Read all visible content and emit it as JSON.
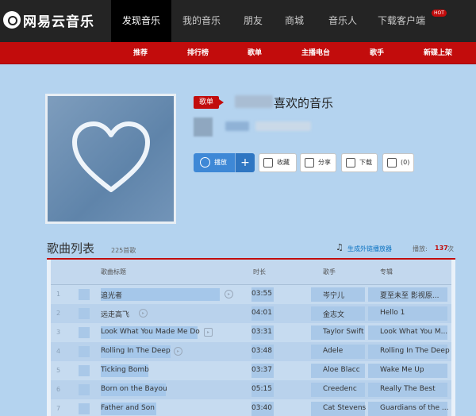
{
  "brand": {
    "logo_text": "网易云音乐"
  },
  "top_nav": [
    {
      "label": "发现音乐",
      "active": true
    },
    {
      "label": "我的音乐",
      "active": false
    },
    {
      "label": "朋友",
      "active": false
    },
    {
      "label": "商城",
      "active": false
    },
    {
      "label": "音乐人",
      "active": false
    },
    {
      "label": "下载客户端",
      "active": false
    }
  ],
  "hot_badge": "HOT",
  "sub_nav": [
    "推荐",
    "排行榜",
    "歌单",
    "主播电台",
    "歌手",
    "新碟上架"
  ],
  "playlist": {
    "tag": "歌单",
    "title": "喜欢的音乐",
    "buttons": {
      "play": "播放",
      "add": "+",
      "collect": "收藏",
      "share": "分享",
      "download": "下载",
      "comment": "(0)"
    }
  },
  "song_list": {
    "title": "歌曲列表",
    "count": "225首歌",
    "link": "生成外链播放器",
    "play_label": "播放:",
    "play_count": "137",
    "play_unit": "次",
    "headers": {
      "title": "歌曲标题",
      "duration": "时长",
      "singer": "歌手",
      "album": "专辑"
    },
    "rows": [
      {
        "num": "1",
        "title": "追光者",
        "duration": "03:55",
        "singer": "岑宁儿",
        "album": "夏至未至 影视原..."
      },
      {
        "num": "2",
        "title": "远走高飞",
        "duration": "04:01",
        "singer": "金志文",
        "album": "Hello 1"
      },
      {
        "num": "3",
        "title": "Look What You Made Me Do",
        "duration": "03:31",
        "singer": "Taylor Swift",
        "album": "Look What You M..."
      },
      {
        "num": "4",
        "title": "Rolling In The Deep",
        "duration": "03:48",
        "singer": "Adele",
        "album": "Rolling In The Deep"
      },
      {
        "num": "5",
        "title": "Ticking Bomb",
        "duration": "03:37",
        "singer": "Aloe Blacc",
        "album": "Wake Me Up"
      },
      {
        "num": "6",
        "title": "Born on the Bayou",
        "duration": "05:15",
        "singer": "Creedenc",
        "album": "Really The Best"
      },
      {
        "num": "7",
        "title": "Father and Son",
        "duration": "03:40",
        "singer": "Cat Stevens",
        "album": "Guardians of the ..."
      }
    ]
  }
}
